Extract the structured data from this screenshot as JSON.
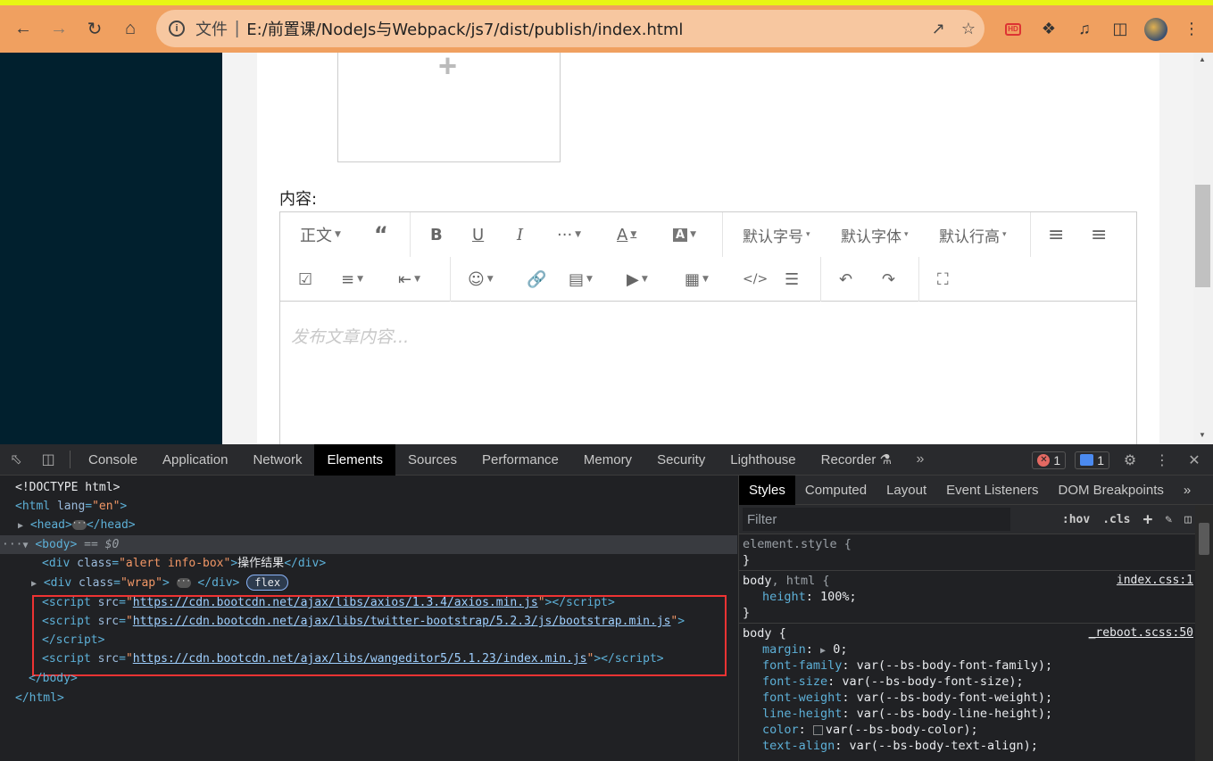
{
  "browser": {
    "url_scheme_label": "文件",
    "url": "E:/前置课/NodeJs与Webpack/js7/dist/publish/index.html",
    "hd_label": "HD",
    "icons": [
      "back-icon",
      "forward-icon",
      "reload-icon",
      "home-icon",
      "info-icon",
      "share-icon",
      "star-icon",
      "extensions-icon",
      "media-icon",
      "sidepanel-icon",
      "menu-icon"
    ]
  },
  "page": {
    "content_label": "内容:",
    "editor_placeholder": "发布文章内容...",
    "toolbar": {
      "paragraph": "正文",
      "font_size": "默认字号",
      "font_family": "默认字体",
      "line_height": "默认行高"
    }
  },
  "devtools": {
    "tabs": [
      "Console",
      "Application",
      "Network",
      "Elements",
      "Sources",
      "Performance",
      "Memory",
      "Security",
      "Lighthouse",
      "Recorder"
    ],
    "active_tab": "Elements",
    "error_count": "1",
    "message_count": "1",
    "dom": {
      "doctype": "<!DOCTYPE html>",
      "html_open": "<html ",
      "html_attr": "lang",
      "html_lang_val": "\"en\"",
      "head_open": "<head>",
      "head_close": "</head>",
      "body_open": "<body>",
      "body_eq": " == $0",
      "div1_attr_val": "\"alert info-box\"",
      "div1_text": "操作结果",
      "div2_attr_val": "\"wrap\"",
      "flex_badge": "flex",
      "script1_src": "https://cdn.bootcdn.net/ajax/libs/axios/1.3.4/axios.min.js",
      "script2_src": "https://cdn.bootcdn.net/ajax/libs/twitter-bootstrap/5.2.3/js/bootstrap.min.js",
      "script3_src": "https://cdn.bootcdn.net/ajax/libs/wangeditor5/5.1.23/index.min.js",
      "body_close": "</body>",
      "html_close": "</html>"
    },
    "styles": {
      "tabs": [
        "Styles",
        "Computed",
        "Layout",
        "Event Listeners",
        "DOM Breakpoints"
      ],
      "filter_placeholder": "Filter",
      "hov": ":hov",
      "cls": ".cls",
      "rules": {
        "r0_selector": "element.style {",
        "r1_selector_a": "body",
        "r1_selector_b": ", html {",
        "r1_source": "index.css:1",
        "r1_prop": "height",
        "r1_val": "100%;",
        "r2_selector": "body {",
        "r2_source": "_reboot.scss:50",
        "margin_prop": "margin",
        "margin_val": "0;",
        "ff_prop": "font-family",
        "ff_val": "var(--bs-body-font-family);",
        "fs_prop": "font-size",
        "fs_val": "var(--bs-body-font-size);",
        "fw_prop": "font-weight",
        "fw_val": "var(--bs-body-font-weight);",
        "lh_prop": "line-height",
        "lh_val": "var(--bs-body-line-height);",
        "color_prop": "color",
        "color_val": "var(--bs-body-color);",
        "ta_prop": "text-align",
        "ta_val": "var(--bs-body-text-align);"
      }
    }
  }
}
